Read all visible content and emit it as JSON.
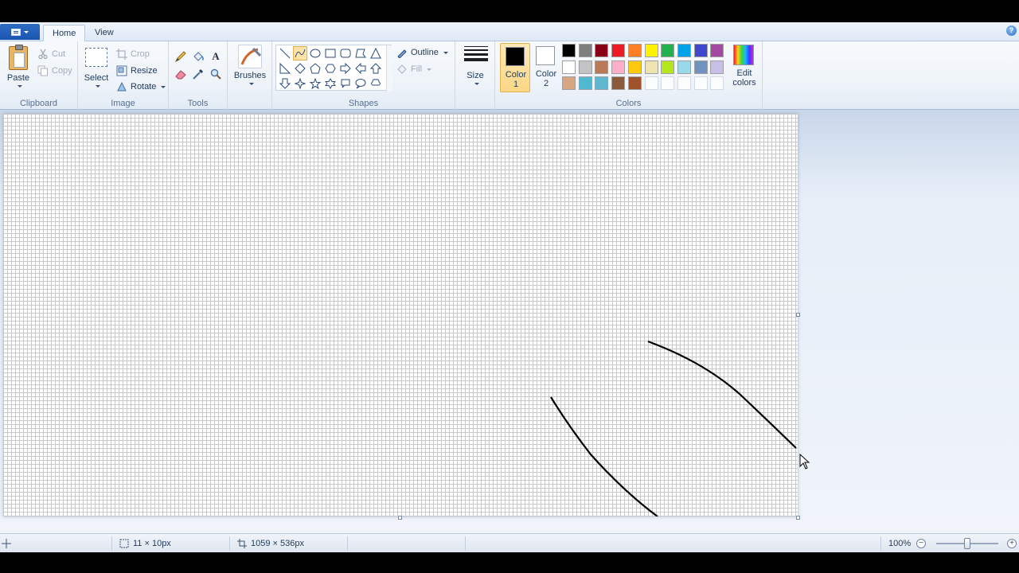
{
  "tabs": [
    {
      "label": "Home",
      "active": true
    },
    {
      "label": "View",
      "active": false
    }
  ],
  "clipboard": {
    "group_label": "Clipboard",
    "paste_label": "Paste",
    "cut_label": "Cut",
    "copy_label": "Copy"
  },
  "image": {
    "group_label": "Image",
    "select_label": "Select",
    "crop_label": "Crop",
    "resize_label": "Resize",
    "rotate_label": "Rotate"
  },
  "tools": {
    "group_label": "Tools",
    "items": [
      "pencil-icon",
      "fill-bucket-icon",
      "text-icon",
      "eraser-icon",
      "color-picker-icon",
      "magnifier-icon"
    ]
  },
  "brushes": {
    "label": "Brushes"
  },
  "shapes": {
    "group_label": "Shapes",
    "outline_label": "Outline",
    "fill_label": "Fill",
    "items": [
      "line",
      "curve",
      "oval",
      "rectangle",
      "rounded-rectangle",
      "polygon",
      "triangle",
      "right-triangle",
      "diamond",
      "pentagon",
      "hexagon",
      "right-arrow",
      "left-arrow",
      "up-arrow",
      "down-arrow",
      "four-point-star",
      "five-point-star",
      "six-point-star",
      "rounded-callout",
      "oval-callout",
      "cloud-callout"
    ],
    "selected": "curve"
  },
  "size": {
    "label": "Size"
  },
  "colors": {
    "group_label": "Colors",
    "color1_label_1": "Color",
    "color1_label_2": "1",
    "color2_label_1": "Color",
    "color2_label_2": "2",
    "color1_value": "#000000",
    "color2_value": "#ffffff",
    "edit_label_1": "Edit",
    "edit_label_2": "colors",
    "palette": [
      [
        "#000000",
        "#7f7f7f",
        "#880015",
        "#ed1c24",
        "#ff7f27",
        "#fff200",
        "#22b14c",
        "#00a2e8",
        "#3f48cc",
        "#a349a4"
      ],
      [
        "#ffffff",
        "#c3c3c3",
        "#b97a57",
        "#ffaec9",
        "#ffc90e",
        "#efe4b0",
        "#b5e61d",
        "#99d9ea",
        "#7092be",
        "#c8bfe7"
      ],
      [
        "#d7a57f",
        "#4fb9d1",
        "#5fb7cf",
        "#8a5a3b",
        "#a0522d",
        null,
        null,
        null,
        null,
        null
      ]
    ]
  },
  "status": {
    "selection_size": "11 × 10px",
    "image_size": "1059 × 536px",
    "zoom": "100%"
  }
}
